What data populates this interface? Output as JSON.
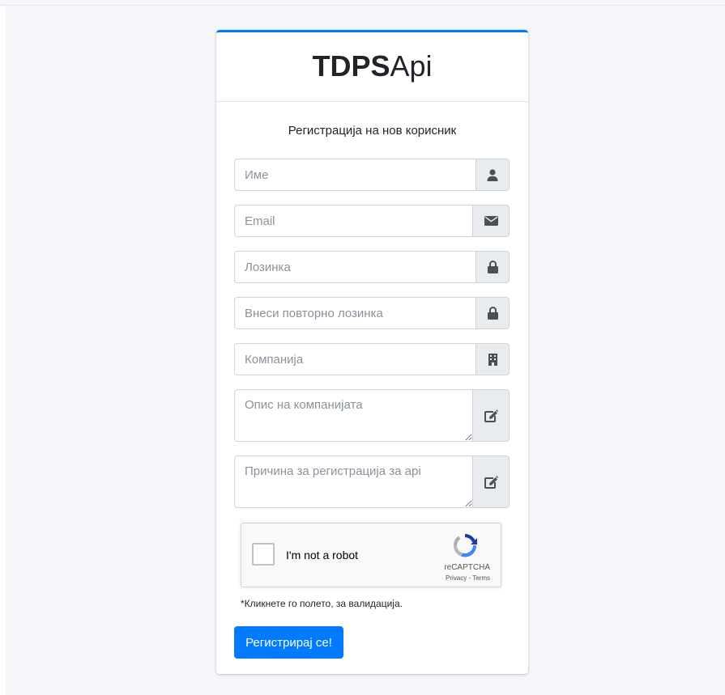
{
  "brand": {
    "bold": "TDPS",
    "light": "Api"
  },
  "form": {
    "title": "Регистрација на нов корисник",
    "fields": {
      "name": {
        "placeholder": "Име",
        "icon": "user-icon"
      },
      "email": {
        "placeholder": "Email",
        "icon": "envelope-icon"
      },
      "password": {
        "placeholder": "Лозинка",
        "icon": "lock-icon"
      },
      "password_repeat": {
        "placeholder": "Внеси повторно лозинка",
        "icon": "lock-icon"
      },
      "company": {
        "placeholder": "Компанија",
        "icon": "building-icon"
      },
      "company_description": {
        "placeholder": "Опис на компанијата",
        "icon": "edit-icon"
      },
      "registration_reason": {
        "placeholder": "Причина за регистрација за api",
        "icon": "edit-icon"
      }
    },
    "recaptcha": {
      "label": "I'm not a robot",
      "brand": "reCAPTCHA",
      "links": "Privacy - Terms"
    },
    "hint": "*Кликнете го полето, за валидација.",
    "submit_label": "Регистрирај се!"
  },
  "colors": {
    "accent": "#007bff",
    "page_bg": "#f4f6f9",
    "addon_bg": "#e9ecef"
  }
}
